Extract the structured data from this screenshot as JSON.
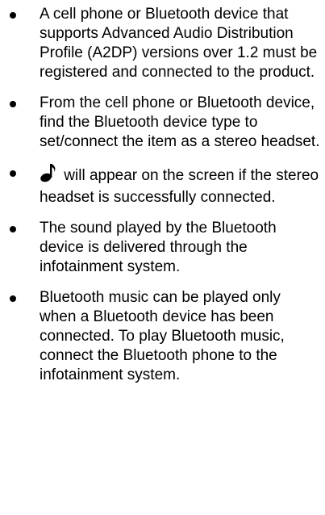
{
  "bullets": [
    {
      "text": "A cell phone or Bluetooth device that supports Advanced Audio Distribution Profile (A2DP) versions over 1.2 must be registered and connected to the product."
    },
    {
      "text": "From the cell phone or Bluetooth device, find the Bluetooth device type to set/connect the item as a stereo headset."
    },
    {
      "icon": "music-note-icon",
      "text": "will appear on the screen if the stereo headset is successfully connected."
    },
    {
      "text": "The sound played by the Bluetooth device is delivered through the infotainment system."
    },
    {
      "text": "Bluetooth music can be played only when a Bluetooth device has been connected. To play Bluetooth music, connect the Bluetooth phone to the infotainment system."
    }
  ]
}
